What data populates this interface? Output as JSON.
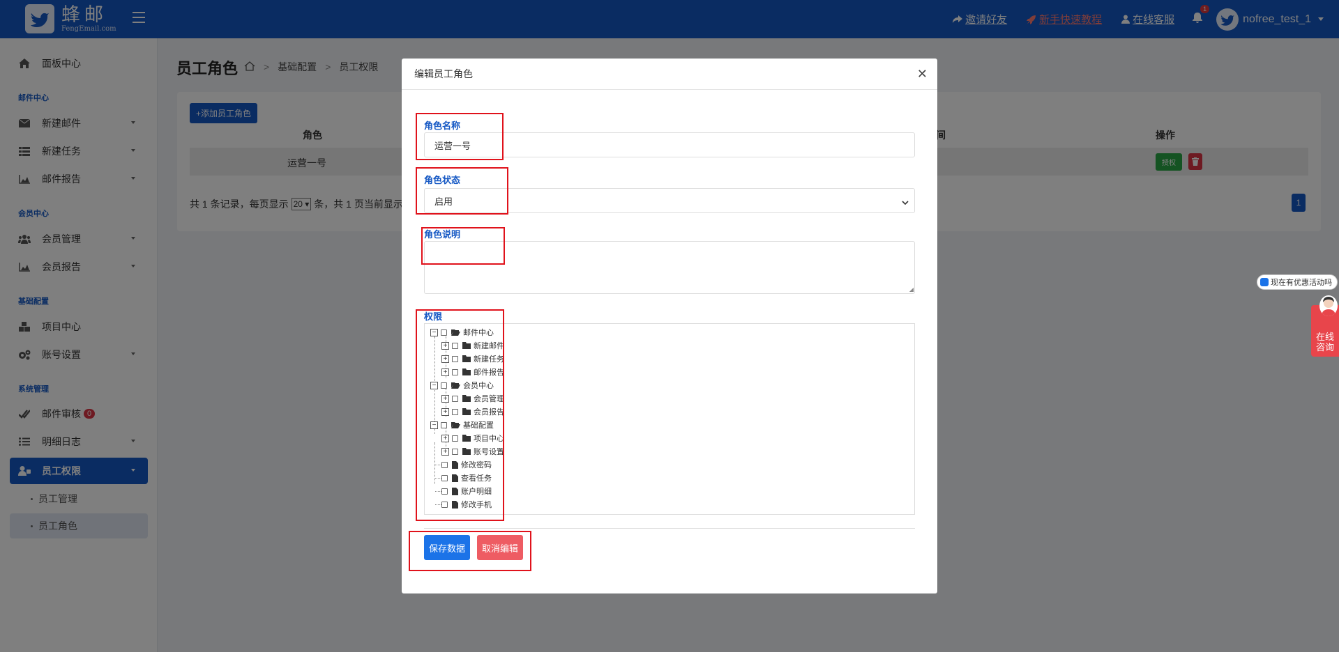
{
  "brand": {
    "name_cn": "蜂邮",
    "name_en": "FengEmail.com"
  },
  "topbar": {
    "invite": "邀请好友",
    "tutorial": "新手快速教程",
    "support": "在线客服",
    "notif_count": "1",
    "username": "nofree_test_1"
  },
  "sidebar": {
    "dashboard": "面板中心",
    "sections": {
      "mail": "邮件中心",
      "member": "会员中心",
      "base": "基础配置",
      "system": "系统管理"
    },
    "items": {
      "new_mail": "新建邮件",
      "new_task": "新建任务",
      "mail_report": "邮件报告",
      "member_manage": "会员管理",
      "member_report": "会员报告",
      "project_center": "项目中心",
      "account_settings": "账号设置",
      "mail_review": "邮件审核",
      "mail_review_badge": "0",
      "detail_log": "明细日志",
      "staff_perm": "员工权限",
      "staff_manage": "员工管理",
      "staff_role": "员工角色"
    }
  },
  "page": {
    "title": "员工角色",
    "breadcrumb": [
      "基础配置",
      "员工权限"
    ],
    "add_button": "添加员工角色",
    "table": {
      "col_role": "角色",
      "col_time": "间",
      "col_action": "操作",
      "row_role": "运营一号",
      "auth_button": "授权"
    },
    "pager": {
      "text1": "共 1 条记录，每页显示",
      "page_size": "20",
      "text2": "条，共 1 页当前显示",
      "current": "1"
    }
  },
  "modal": {
    "title": "编辑员工角色",
    "name_label": "角色名称",
    "name_value": "运营一号",
    "status_label": "角色状态",
    "status_value": "启用",
    "desc_label": "角色说明",
    "desc_value": "",
    "perm_label": "权限",
    "tree": {
      "mail": "邮件中心",
      "new_mail": "新建邮件",
      "new_task": "新建任务",
      "mail_report": "邮件报告",
      "member": "会员中心",
      "member_manage": "会员管理",
      "member_report": "会员报告",
      "base": "基础配置",
      "project_center": "项目中心",
      "account_settings": "账号设置",
      "change_password": "修改密码",
      "view_task": "查看任务",
      "account_detail": "账户明细",
      "change_phone": "修改手机"
    },
    "save_button": "保存数据",
    "cancel_button": "取消编辑"
  },
  "widgets": {
    "promo": "现在有优惠活动吗",
    "consult": [
      "在线",
      "咨询"
    ]
  },
  "colors": {
    "primary": "#1558c4",
    "danger": "#dc3545",
    "success": "#28a745",
    "highlight": "#e0121b"
  }
}
